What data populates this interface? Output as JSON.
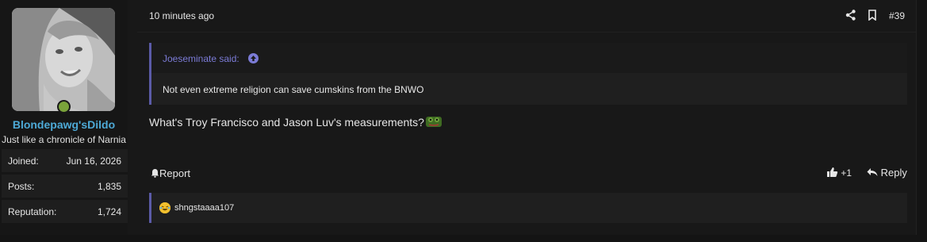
{
  "user": {
    "name": "Blondepawg'sDildo",
    "title": "Just like a chronicle of Narnia",
    "online_color": "#7aa33a",
    "stats": [
      {
        "label": "Joined:",
        "value": "Jun 16, 2026"
      },
      {
        "label": "Posts:",
        "value": "1,835"
      },
      {
        "label": "Reputation:",
        "value": "1,724"
      }
    ]
  },
  "header": {
    "timestamp": "10 minutes ago",
    "post_number": "#39"
  },
  "quote": {
    "author": "Joeseminate said:",
    "text": "Not even extreme religion can save cumskins from the BNWO"
  },
  "message": {
    "text": "What's Troy Francisco and Jason Luv's measurements?"
  },
  "actions": {
    "report": "Report",
    "like_count": "+1",
    "reply": "Reply"
  },
  "reactions": {
    "user": "shngstaaaa107"
  },
  "colors": {
    "accent": "#5b5ba8",
    "username": "#4da9d6",
    "quote_author": "#7b7bd6"
  }
}
